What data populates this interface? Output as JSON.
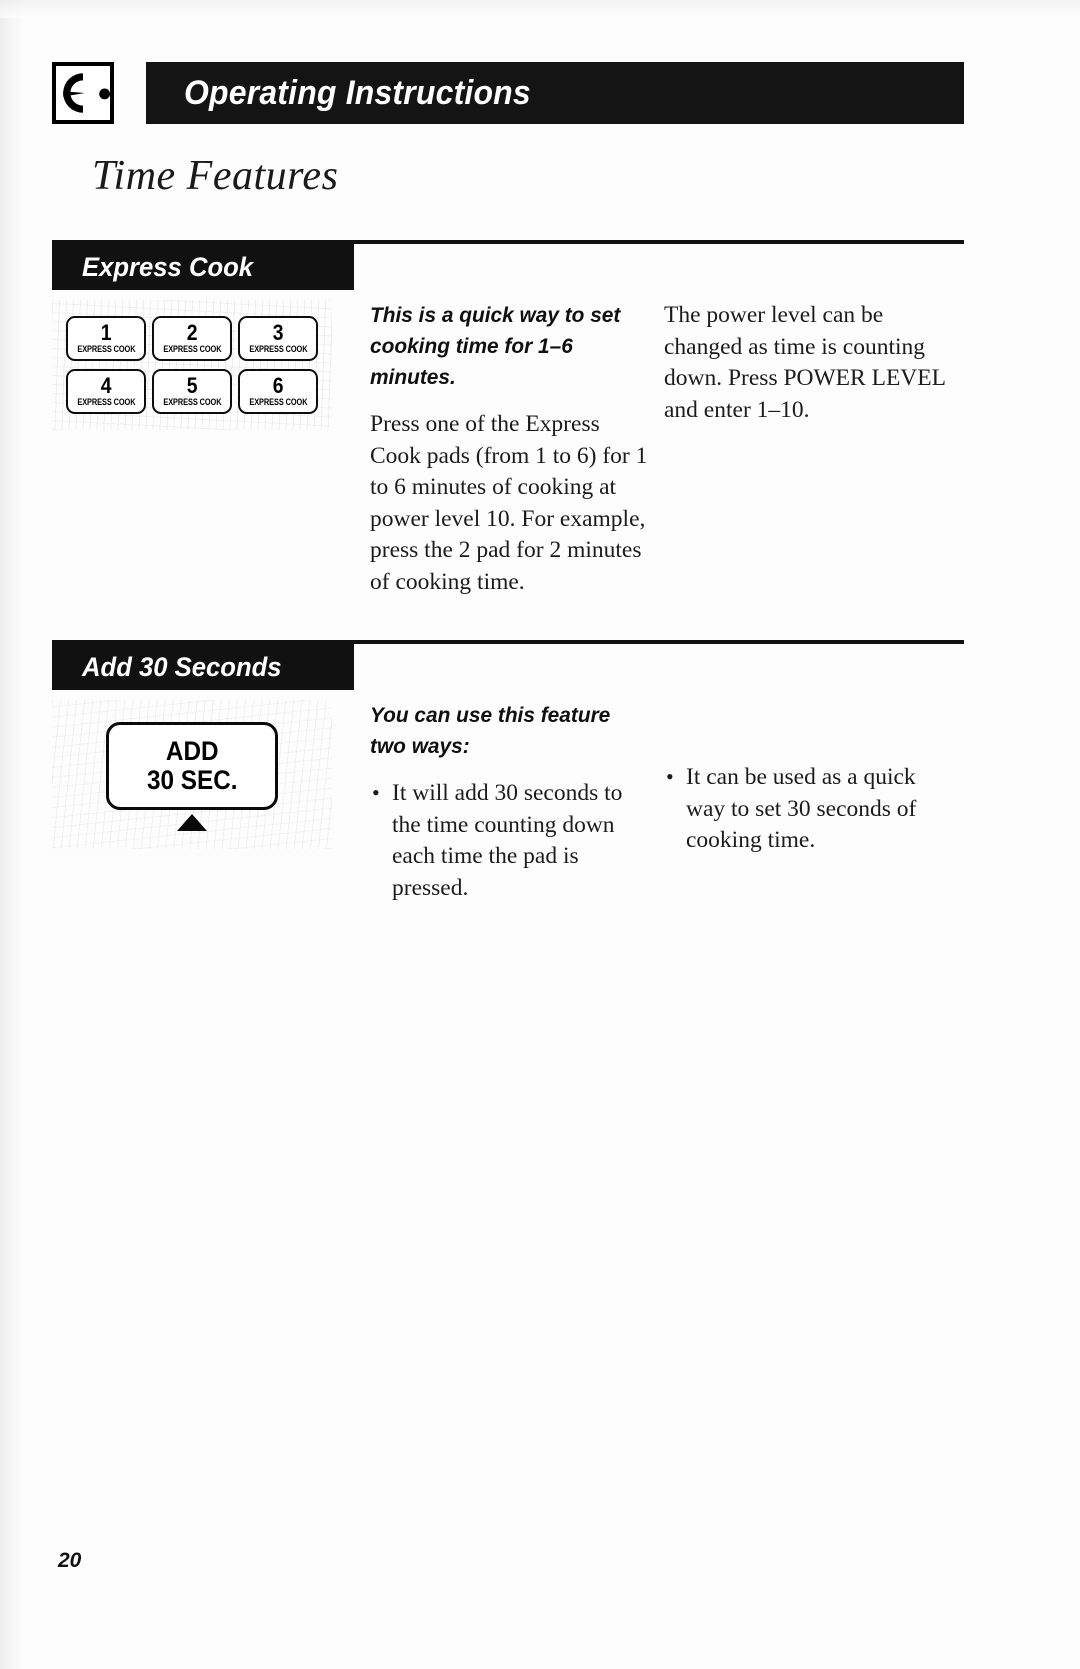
{
  "header": {
    "icon_name": "oven-dial-icon",
    "banner_title": "Operating Instructions"
  },
  "page_title": "Time Features",
  "sections": [
    {
      "id": "express-cook",
      "heading": "Express Cook",
      "artwork": {
        "type": "keypad",
        "pads": [
          {
            "number": "1",
            "sublabel": "EXPRESS COOK"
          },
          {
            "number": "2",
            "sublabel": "EXPRESS COOK"
          },
          {
            "number": "3",
            "sublabel": "EXPRESS COOK"
          },
          {
            "number": "4",
            "sublabel": "EXPRESS COOK"
          },
          {
            "number": "5",
            "sublabel": "EXPRESS COOK"
          },
          {
            "number": "6",
            "sublabel": "EXPRESS COOK"
          }
        ]
      },
      "middle_column": {
        "lead": "This is a quick way to set cooking time for 1–6 minutes.",
        "body": "Press one of the Express Cook pads (from 1 to 6) for 1 to 6 minutes of cooking at power level 10. For example, press the 2 pad for 2 minutes of cooking time."
      },
      "right_column": {
        "body": "The power level can be changed as time is counting down. Press POWER LEVEL and enter 1–10."
      }
    },
    {
      "id": "add-30-seconds",
      "heading": "Add 30 Seconds",
      "artwork": {
        "type": "add30-pad",
        "line1": "ADD",
        "line2": "30 SEC.",
        "arrow": "triangle-up-icon"
      },
      "middle_column": {
        "lead": "You can use this feature two ways:",
        "bullets": [
          "It will add 30 seconds to the time counting down each time the pad is pressed."
        ]
      },
      "right_column": {
        "bullets": [
          "It can be used as a quick way to set 30 seconds of cooking time."
        ]
      }
    }
  ],
  "page_number": "20"
}
